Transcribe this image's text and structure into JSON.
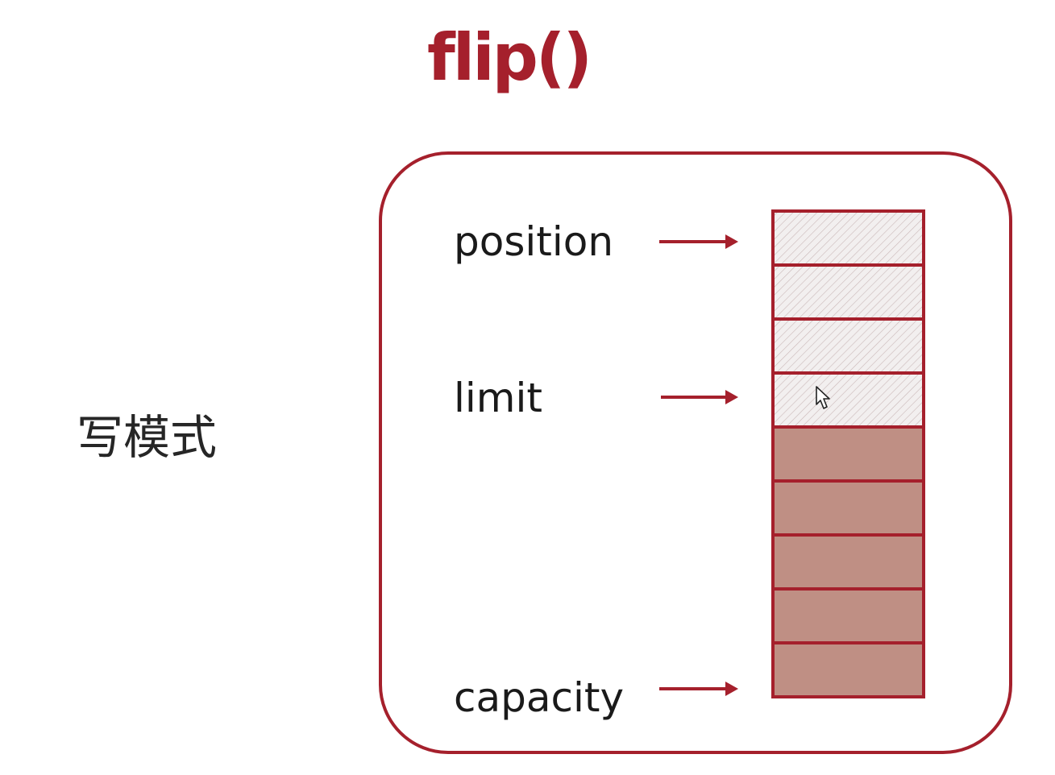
{
  "title": "flip()",
  "mode_label": "写模式",
  "pointers": {
    "position": "position",
    "limit": "limit",
    "capacity": "capacity"
  },
  "buffer": {
    "total_cells": 9,
    "hatched_cells": 4,
    "filled_cells": 5
  },
  "colors": {
    "accent": "#a5202c",
    "filled_cell": "#bf8f84",
    "hatched_cell_bg": "#f2efef",
    "hatch_line": "#c9b8b8"
  },
  "icons": {
    "cursor": "mouse-pointer-icon"
  }
}
